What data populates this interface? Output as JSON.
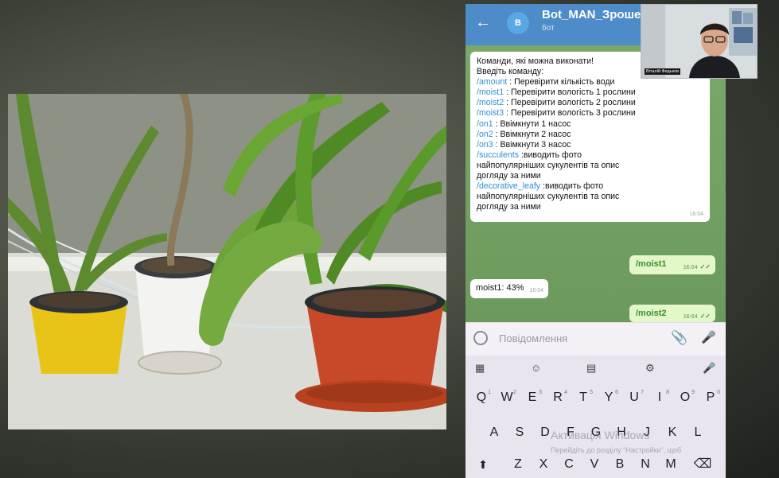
{
  "chat_header": {
    "bot_name": "Bot_MAN_Зрошен",
    "subtitle": "бот",
    "avatar_letter": "B"
  },
  "commands_message": {
    "intro": [
      "Команди, які можна виконати!",
      "Введіть команду:"
    ],
    "commands": [
      {
        "cmd": "/amount",
        "desc": " : Перевірити кількість води"
      },
      {
        "cmd": "/moist1",
        "desc": " : Перевірити вологість 1 рослини"
      },
      {
        "cmd": "/moist2",
        "desc": " : Перевірити вологість 2 рослини"
      },
      {
        "cmd": "/moist3",
        "desc": " : Перевірити вологість 3 рослини"
      },
      {
        "cmd": "/on1",
        "desc": " : Ввімкнути 1 насос"
      },
      {
        "cmd": "/on2",
        "desc": " : Ввімкнути 2 насос"
      },
      {
        "cmd": "/on3",
        "desc": " : Ввімкнути 3 насос"
      }
    ],
    "succulents_cmd": "/succulents",
    "succulents_desc_1": " :виводить фото",
    "succulents_desc_2": "найпопулярніших сукулентів та опис",
    "succulents_desc_3": "догляду за ними",
    "decorative_cmd": "/decorative_leafy",
    "decorative_desc_1": " :виводить фото",
    "decorative_desc_2": "найпопулярніших сукулентів та опис",
    "decorative_desc_3": "догляду за ними",
    "time": "16:04"
  },
  "messages": [
    {
      "text": "/moist1",
      "time": "16:04",
      "direction": "out"
    },
    {
      "text": "moist1: 43%",
      "time": "16:04",
      "direction": "in"
    },
    {
      "text": "/moist2",
      "time": "16:04",
      "direction": "out"
    }
  ],
  "input": {
    "placeholder": "Повідомлення"
  },
  "keyboard": {
    "row1": [
      {
        "k": "Q",
        "n": "1"
      },
      {
        "k": "W",
        "n": "2"
      },
      {
        "k": "E",
        "n": "3"
      },
      {
        "k": "R",
        "n": "4"
      },
      {
        "k": "T",
        "n": "5"
      },
      {
        "k": "Y",
        "n": "6"
      },
      {
        "k": "U",
        "n": "7"
      },
      {
        "k": "I",
        "n": "8"
      },
      {
        "k": "O",
        "n": "9"
      },
      {
        "k": "P",
        "n": "0"
      }
    ],
    "row2": [
      "A",
      "S",
      "D",
      "F",
      "G",
      "H",
      "J",
      "K",
      "L"
    ],
    "row3": [
      "Z",
      "X",
      "C",
      "V",
      "B",
      "N",
      "M"
    ]
  },
  "watermark": {
    "line1": "Активація Windows",
    "line2": "Перейдіть до розділу \"Настройки\", щоб"
  },
  "webcam": {
    "name_label": "Віталій Федьков"
  },
  "colors": {
    "header_blue": "#4d8bc9",
    "chat_green": "#7aa86b",
    "command_link": "#2f8fd1",
    "outgoing_bubble": "#e3f7c9"
  }
}
